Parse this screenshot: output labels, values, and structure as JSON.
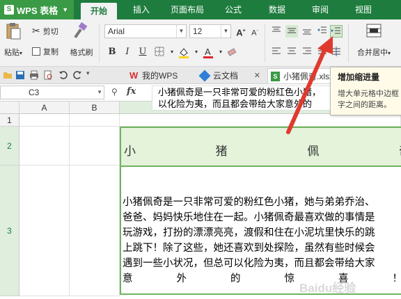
{
  "app": {
    "title": "WPS 表格",
    "logo": "S"
  },
  "menu": {
    "tabs": [
      "开始",
      "插入",
      "页面布局",
      "公式",
      "数据",
      "审阅",
      "视图"
    ]
  },
  "ribbon": {
    "paste_label": "粘贴",
    "cut_label": "剪切",
    "copy_label": "复制",
    "format_painter_label": "格式刷",
    "font_name": "Arial",
    "font_size": "12",
    "merge_center_label": "合并居中",
    "bold": "B",
    "italic": "I",
    "underline": "U"
  },
  "doc_tabs": [
    {
      "label": "我的WPS"
    },
    {
      "label": "云文档"
    },
    {
      "label": "小猪佩奇.xlsx"
    }
  ],
  "formula_bar": {
    "cell_ref": "C3",
    "fx": "fx",
    "content_line1": "小猪佩奇是一只非常可爱的粉红色小猪，",
    "content_line2": "以化险为夷，而且都会带给大家意外的"
  },
  "tooltip": {
    "title": "增加缩进量",
    "desc_line1": "增大单元格中边框",
    "desc_line2": "字之间的距离。"
  },
  "grid": {
    "columns": [
      "A",
      "B"
    ],
    "rows": [
      "1",
      "2",
      "3"
    ],
    "c2_chars": [
      "小",
      "猪",
      "佩",
      "奇"
    ],
    "c3_lines": [
      "小猪佩奇是一只非常可爱的粉红色小猪，她与弟弟乔治、",
      "爸爸、妈妈快乐地住在一起。小猪佩奇最喜欢做的事情是",
      "玩游戏，打扮的漂漂亮亮，渡假和住在小泥坑里快乐的跳",
      "上跳下！除了这些，她还喜欢到处探险，虽然有些时候会",
      "遇到一些小状况，但总可以化险为夷，而且都会带给大家"
    ],
    "c3_last_chars": [
      "意",
      "外",
      "的",
      "惊",
      "喜",
      "！"
    ]
  },
  "watermark": "Baidu经验",
  "colors": {
    "brand_green": "#1e7d3e",
    "selection_green": "#6fb35f",
    "arrow_red": "#e03a2f"
  }
}
